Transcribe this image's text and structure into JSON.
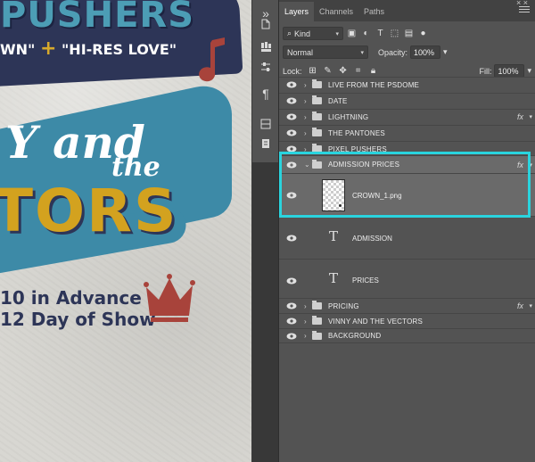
{
  "poster": {
    "title_top": "PUSHERS",
    "subtitle_left": "WN\"",
    "subtitle_plus": "+",
    "subtitle_right": "\"HI-RES LOVE\"",
    "and_text": "Y and",
    "the_text": "the",
    "vectors_text": "TORS",
    "price_line_1": "10 in Advance",
    "price_line_2": "12 Day of Show",
    "colors": {
      "navy": "#2d3557",
      "teal": "#3d8aa7",
      "gold": "#d3a21f",
      "red": "#a8433b"
    }
  },
  "panel": {
    "tabs": [
      {
        "label": "Layers",
        "active": true
      },
      {
        "label": "Channels",
        "active": false
      },
      {
        "label": "Paths",
        "active": false
      }
    ],
    "close_label": "× ×",
    "filter": {
      "kind_label": "Kind"
    },
    "blend": {
      "mode": "Normal",
      "opacity_label": "Opacity:",
      "opacity_value": "100%"
    },
    "lock": {
      "label": "Lock:",
      "fill_label": "Fill:",
      "fill_value": "100%"
    },
    "layers": [
      {
        "name": "LIVE FROM THE PSDOME",
        "type": "group",
        "fx": false
      },
      {
        "name": "DATE",
        "type": "group",
        "fx": false
      },
      {
        "name": "LIGHTNING",
        "type": "group",
        "fx": true
      },
      {
        "name": "THE PANTONES",
        "type": "group",
        "fx": false
      },
      {
        "name": "PIXEL PUSHERS",
        "type": "group",
        "fx": false
      },
      {
        "name": "ADMISSION PRICES",
        "type": "group-open",
        "fx": true,
        "selected": true
      },
      {
        "name": "CROWN_1.png",
        "type": "image",
        "selected": true
      },
      {
        "name": "ADMISSION",
        "type": "text"
      },
      {
        "name": "PRICES",
        "type": "text"
      },
      {
        "name": "PRICING",
        "type": "group",
        "fx": true
      },
      {
        "name": "VINNY AND THE VECTORS",
        "type": "group",
        "fx": false
      },
      {
        "name": "BACKGROUND",
        "type": "group",
        "fx": false
      }
    ],
    "fx_label": "fx",
    "highlight_color": "#2ad4de"
  }
}
